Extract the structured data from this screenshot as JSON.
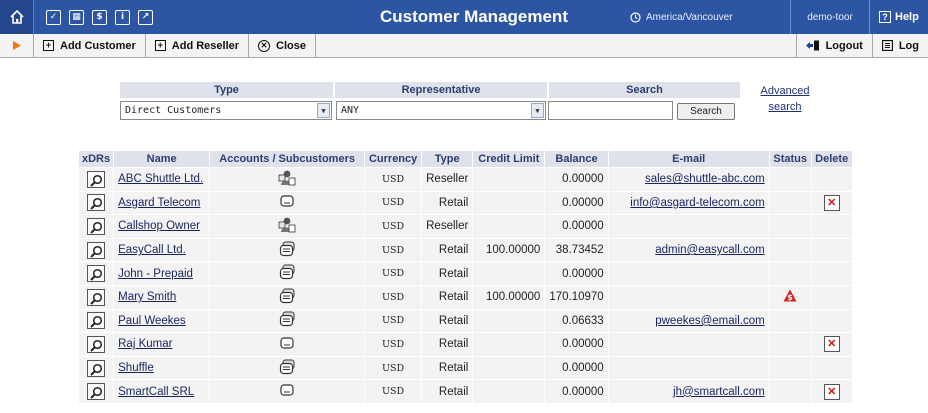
{
  "app": {
    "title": "Customer Management",
    "timezone": "America/Vancouver",
    "user": "demo-toor",
    "help_label": "Help"
  },
  "toolbar": {
    "add_customer": "Add Customer",
    "add_reseller": "Add Reseller",
    "close": "Close",
    "logout": "Logout",
    "log": "Log"
  },
  "filters": {
    "type_label": "Type",
    "type_value": "Direct Customers",
    "rep_label": "Representative",
    "rep_value": "ANY",
    "search_label": "Search",
    "search_value": "",
    "search_button": "Search",
    "advanced_line1": "Advanced",
    "advanced_line2": "search"
  },
  "table": {
    "columns": [
      "xDRs",
      "Name",
      "Accounts / Subcustomers",
      "Currency",
      "Type",
      "Credit Limit",
      "Balance",
      "E-mail",
      "Status",
      "Delete"
    ],
    "rows": [
      {
        "name": "ABC Shuttle Ltd.",
        "icon": "operator-icon",
        "currency": "USD",
        "type": "Reseller",
        "credit_limit": "",
        "balance": "0.00000",
        "email": "sales@shuttle-abc.com",
        "status": "",
        "deletable": false
      },
      {
        "name": "Asgard Telecom",
        "icon": "phone-icon",
        "currency": "USD",
        "type": "Retail",
        "credit_limit": "",
        "balance": "0.00000",
        "email": "info@asgard-telecom.com",
        "status": "",
        "deletable": true
      },
      {
        "name": "Callshop Owner",
        "icon": "operator-icon",
        "currency": "USD",
        "type": "Reseller",
        "credit_limit": "",
        "balance": "0.00000",
        "email": "",
        "status": "",
        "deletable": false
      },
      {
        "name": "EasyCall Ltd.",
        "icon": "phones-icon",
        "currency": "USD",
        "type": "Retail",
        "credit_limit": "100.00000",
        "balance": "38.73452",
        "email": "admin@easycall.com",
        "status": "",
        "deletable": false
      },
      {
        "name": "John - Prepaid",
        "icon": "phones-icon",
        "currency": "USD",
        "type": "Retail",
        "credit_limit": "",
        "balance": "0.00000",
        "email": "",
        "status": "",
        "deletable": false
      },
      {
        "name": "Mary Smith",
        "icon": "phones-icon",
        "currency": "USD",
        "type": "Retail",
        "credit_limit": "100.00000",
        "balance": "170.10970",
        "email": "",
        "status": "warning-icon",
        "deletable": false
      },
      {
        "name": "Paul Weekes",
        "icon": "phones-icon",
        "currency": "USD",
        "type": "Retail",
        "credit_limit": "",
        "balance": "0.06633",
        "email": "pweekes@email.com",
        "status": "",
        "deletable": false
      },
      {
        "name": "Raj Kumar",
        "icon": "phone-icon",
        "currency": "USD",
        "type": "Retail",
        "credit_limit": "",
        "balance": "0.00000",
        "email": "",
        "status": "",
        "deletable": true
      },
      {
        "name": "Shuffle",
        "icon": "phones-icon",
        "currency": "USD",
        "type": "Retail",
        "credit_limit": "",
        "balance": "0.00000",
        "email": "",
        "status": "",
        "deletable": false
      },
      {
        "name": "SmartCall SRL",
        "icon": "phone-icon",
        "currency": "USD",
        "type": "Retail",
        "credit_limit": "",
        "balance": "0.00000",
        "email": "jh@smartcall.com",
        "status": "",
        "deletable": true
      }
    ]
  }
}
